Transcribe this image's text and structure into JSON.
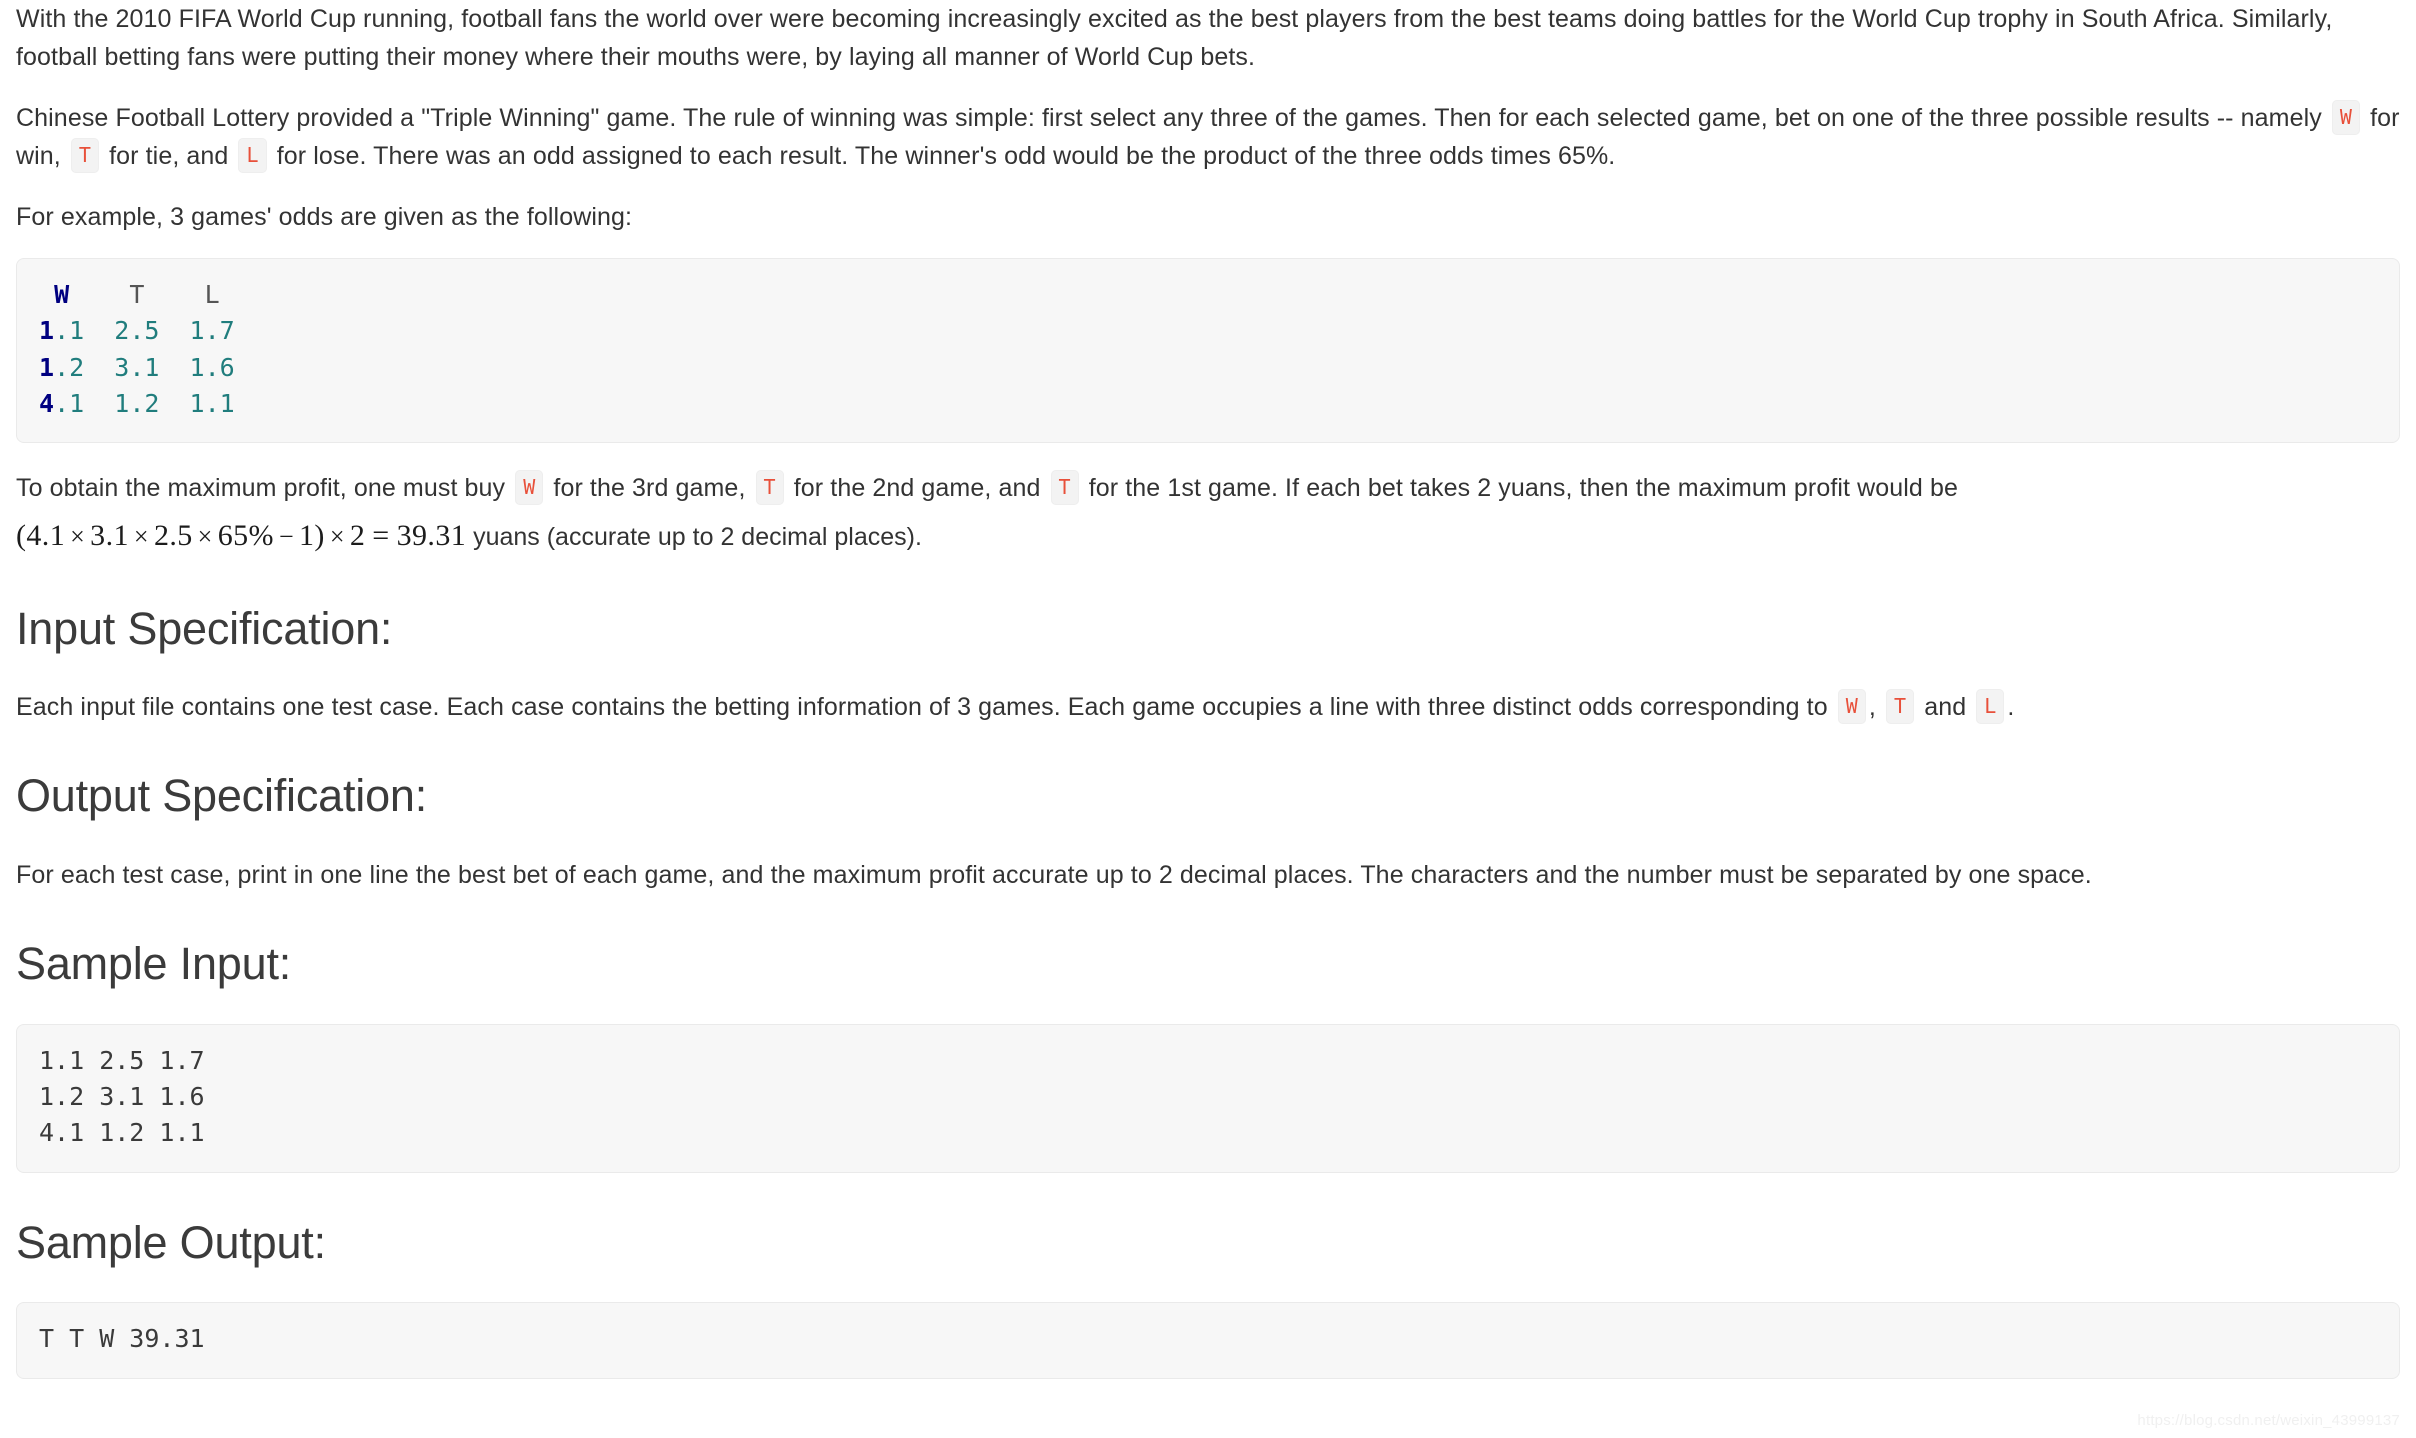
{
  "document": {
    "intro_paragraph": "With the 2010 FIFA World Cup running, football fans the world over were becoming increasingly excited as the best players from the best teams doing battles for the World Cup trophy in South Africa. Similarly, football betting fans were putting their money where their mouths were, by laying all manner of World Cup bets.",
    "rules_paragraph": {
      "part1": "Chinese Football Lottery provided a \"Triple Winning\" game. The rule of winning was simple: first select any three of the games. Then for each selected game, bet on one of the three possible results -- namely",
      "badge_w": "W",
      "part2": "for win,",
      "badge_t": "T",
      "part3": "for tie, and",
      "badge_l": "L",
      "part4": "for lose. There was an odd assigned to each result. The winner's odd would be the product of the three odds times 65%."
    },
    "example_lead": "For example, 3 games' odds are given as the following:",
    "odds_table": {
      "header": {
        "w": "W",
        "t": "T",
        "l": "L"
      },
      "rows": [
        {
          "w_first": "1",
          "w_rest": ".1",
          "t": "2.5",
          "l": "1.7"
        },
        {
          "w_first": "1",
          "w_rest": ".2",
          "t": "3.1",
          "l": "1.6"
        },
        {
          "w_first": "4",
          "w_rest": ".1",
          "t": "1.2",
          "l": "1.1"
        }
      ]
    },
    "profit_paragraph": {
      "part1": "To obtain the maximum profit, one must buy",
      "badge_1": "W",
      "part2": "for the 3rd game,",
      "badge_2": "T",
      "part3": "for the 2nd game, and",
      "badge_3": "T",
      "part4": "for the 1st game. If each bet takes 2 yuans, then the maximum profit would be"
    },
    "formula": {
      "open": "(",
      "a": "4.1",
      "mul1": "×",
      "b": "3.1",
      "mul2": "×",
      "c": "2.5",
      "mul3": "×",
      "d": "65%",
      "minus": "−",
      "one": "1",
      "close": ")",
      "mul4": "×",
      "two": "2",
      "equals": "=",
      "result": "39.31",
      "trailing": "yuans (accurate up to 2 decimal places)."
    },
    "input_spec": {
      "heading": "Input Specification:",
      "part1": "Each input file contains one test case. Each case contains the betting information of 3 games. Each game occupies a line with three distinct odds corresponding to",
      "badge_w": "W",
      "comma": ",",
      "badge_t": "T",
      "part2": "and",
      "badge_l": "L",
      "period": "."
    },
    "output_spec": {
      "heading": "Output Specification:",
      "body": "For each test case, print in one line the best bet of each game, and the maximum profit accurate up to 2 decimal places. The characters and the number must be separated by one space."
    },
    "sample_input": {
      "heading": "Sample Input:",
      "lines": [
        "1.1 2.5 1.7",
        "1.2 3.1 1.6",
        "4.1 1.2 1.1"
      ]
    },
    "sample_output": {
      "heading": "Sample Output:",
      "lines": [
        "T T W 39.31"
      ]
    },
    "watermark": "https://blog.csdn.net/weixin_43999137"
  },
  "colors": {
    "page_background": "#ffffff",
    "body_text": "#333333",
    "heading_text": "#3b3b3b",
    "code_block_background": "#f7f7f7",
    "code_block_border": "#eaeaea",
    "inline_code_text": "#e8503a",
    "inline_code_background": "#f3f3f3",
    "syntax_keyword": "#000080",
    "syntax_number": "#207d7d",
    "syntax_plain": "#555555",
    "watermark_text": "#f0f0f0"
  }
}
